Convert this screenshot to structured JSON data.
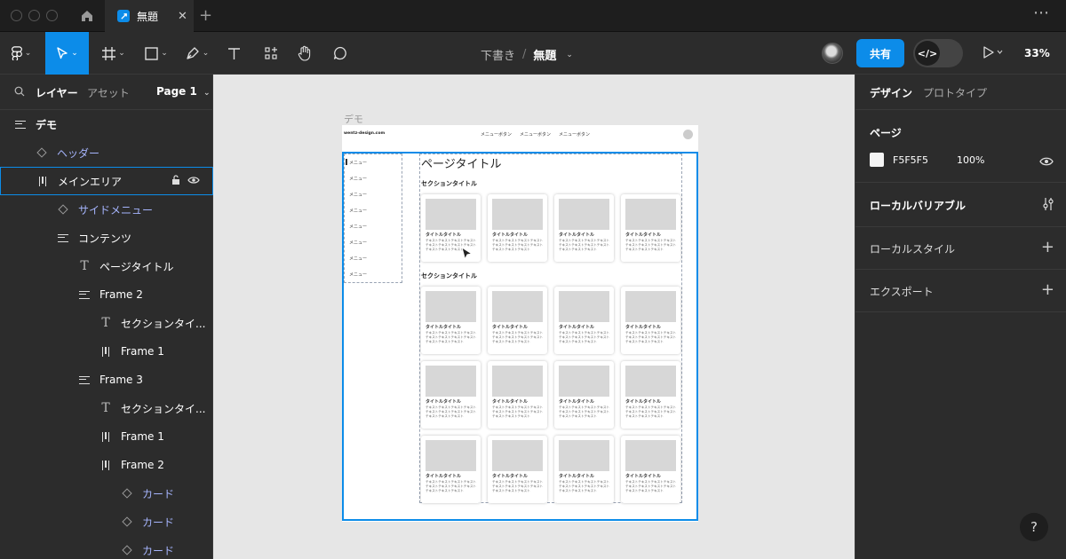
{
  "tabbar": {
    "tab_title": "無題",
    "close_glyph": "✕",
    "new_tab_glyph": "+",
    "more_glyph": "⋯"
  },
  "toolbar": {
    "breadcrumb_draft": "下書き",
    "breadcrumb_sep": "/",
    "file_name": "無題",
    "share_label": "共有",
    "dev_mode_glyph": "</>",
    "zoom": "33%"
  },
  "left_panel": {
    "tab_layers": "レイヤー",
    "tab_assets": "アセット",
    "page": "Page 1",
    "layers": [
      {
        "label": "デモ",
        "type": "frame",
        "depth": 0
      },
      {
        "label": "ヘッダー",
        "type": "component",
        "depth": 1
      },
      {
        "label": "メインエリア",
        "type": "autolayout-h",
        "depth": 1,
        "selected": true
      },
      {
        "label": "サイドメニュー",
        "type": "component",
        "depth": 2
      },
      {
        "label": "コンテンツ",
        "type": "autolayout-v",
        "depth": 2
      },
      {
        "label": "ページタイトル",
        "type": "text",
        "depth": 3
      },
      {
        "label": "Frame 2",
        "type": "autolayout-v",
        "depth": 3
      },
      {
        "label": "セクションタイ...",
        "type": "text",
        "depth": 4
      },
      {
        "label": "Frame 1",
        "type": "autolayout-h",
        "depth": 4
      },
      {
        "label": "Frame 3",
        "type": "autolayout-v",
        "depth": 3
      },
      {
        "label": "セクションタイ...",
        "type": "text",
        "depth": 4
      },
      {
        "label": "Frame 1",
        "type": "autolayout-h",
        "depth": 4
      },
      {
        "label": "Frame 2",
        "type": "autolayout-h",
        "depth": 4
      },
      {
        "label": "カード",
        "type": "component",
        "depth": 5
      },
      {
        "label": "カード",
        "type": "component",
        "depth": 5
      },
      {
        "label": "カード",
        "type": "component",
        "depth": 5
      }
    ]
  },
  "canvas": {
    "frame_label": "デモ",
    "site_logo": "wentz-design.com",
    "nav_items": [
      "メニューボタン",
      "メニューボタン",
      "メニューボタン"
    ],
    "side_menu_items": [
      "メニュー",
      "メニュー",
      "メニュー",
      "メニュー",
      "メニュー",
      "メニュー",
      "メニュー",
      "メニュー"
    ],
    "page_title": "ページタイトル",
    "section_titles": [
      "セクションタイトル",
      "セクションタイトル"
    ],
    "card_title": "タイトルタイトル",
    "card_text": "テキストテキストテキストテキストテキストテキストテキストテキストテキストテキストテキスト"
  },
  "right_panel": {
    "tab_design": "デザイン",
    "tab_prototype": "プロトタイプ",
    "page_section_title": "ページ",
    "page_color": "F5F5F5",
    "page_opacity": "100%",
    "local_variables": "ローカルバリアブル",
    "local_styles": "ローカルスタイル",
    "export": "エクスポート"
  },
  "help_glyph": "?",
  "colors": {
    "accent": "#0c8ce9",
    "component": "#a5b4fc",
    "panel_bg": "#2c2c2c",
    "canvas_bg": "#e6e6e6"
  }
}
